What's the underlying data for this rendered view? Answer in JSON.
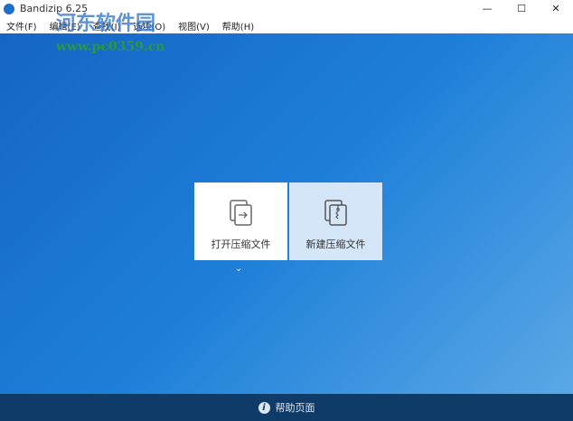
{
  "window": {
    "title": "Bandizip 6.25",
    "controls": [
      "—",
      "☐",
      "✕"
    ]
  },
  "menu": [
    "文件(F)",
    "编辑(E)",
    "查找(I)",
    "选项(O)",
    "视图(V)",
    "帮助(H)"
  ],
  "actions": {
    "open_label": "打开压缩文件",
    "new_label": "新建压缩文件",
    "more": "⌄"
  },
  "footer": {
    "help_label": "帮助页面",
    "icon": "i"
  },
  "watermark": {
    "name": "河东软件园",
    "url": "www.pc0359.cn"
  }
}
